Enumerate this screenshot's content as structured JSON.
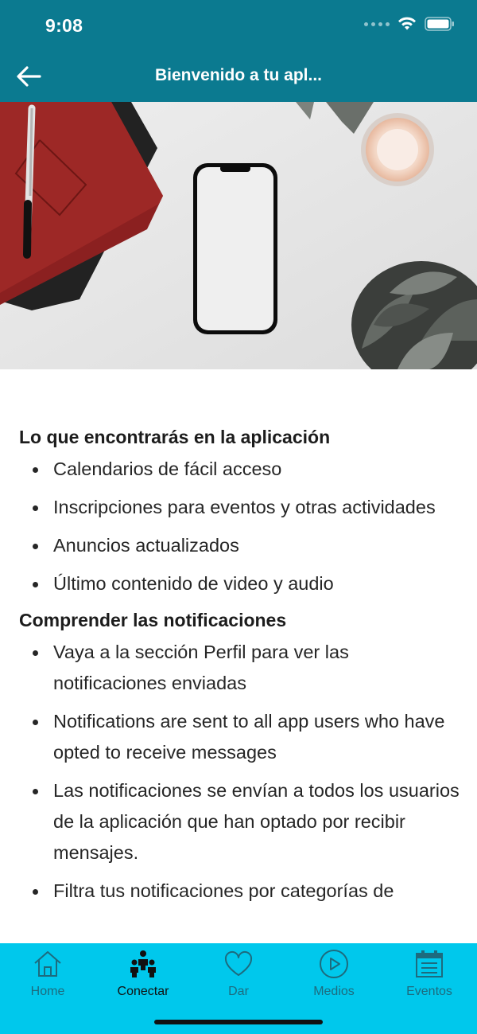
{
  "status_bar": {
    "time": "9:08"
  },
  "header": {
    "title": "Bienvenido a tu apl..."
  },
  "content": {
    "sections": [
      {
        "heading": "Lo que encontrarás en la aplicación",
        "items": [
          "Calendarios de fácil acceso",
          "Inscripciones para eventos y otras actividades",
          "Anuncios actualizados",
          "Último contenido de video y audio"
        ]
      },
      {
        "heading": "Comprender las notificaciones",
        "items": [
          "Vaya a la sección Perfil para ver las notificaciones enviadas",
          "Notifications are sent to all app users who have opted to receive messages",
          "Las notificaciones se envían a todos los usuarios de la aplicación que han optado por recibir mensajes.",
          "Filtra tus notificaciones por categorías de"
        ]
      }
    ]
  },
  "tabbar": {
    "tabs": [
      {
        "label": "Home",
        "icon": "home-icon"
      },
      {
        "label": "Conectar",
        "icon": "people-icon",
        "active": true
      },
      {
        "label": "Dar",
        "icon": "heart-icon"
      },
      {
        "label": "Medios",
        "icon": "play-icon"
      },
      {
        "label": "Eventos",
        "icon": "calendar-icon"
      }
    ]
  },
  "colors": {
    "header": "#0b7a90",
    "tabbar": "#00c8ec",
    "tab_inactive": "#1d6b7e",
    "tab_active": "#111111"
  }
}
